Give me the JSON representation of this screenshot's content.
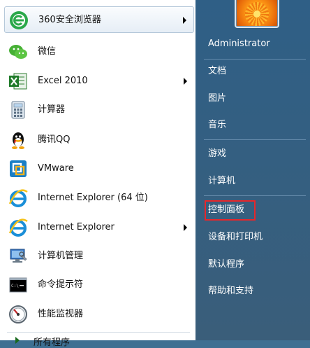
{
  "left_items": [
    {
      "label": "360安全浏览器",
      "icon": "360-browser-icon",
      "has_arrow": true
    },
    {
      "label": "微信",
      "icon": "wechat-icon",
      "has_arrow": false
    },
    {
      "label": "Excel 2010",
      "icon": "excel-icon",
      "has_arrow": true
    },
    {
      "label": "计算器",
      "icon": "calculator-icon",
      "has_arrow": false
    },
    {
      "label": "腾讯QQ",
      "icon": "qq-icon",
      "has_arrow": false
    },
    {
      "label": "VMware",
      "icon": "vmware-icon",
      "has_arrow": false
    },
    {
      "label": "Internet Explorer (64 位)",
      "icon": "ie-icon",
      "has_arrow": false
    },
    {
      "label": "Internet Explorer",
      "icon": "ie-icon",
      "has_arrow": true
    },
    {
      "label": "计算机管理",
      "icon": "computer-management-icon",
      "has_arrow": false
    },
    {
      "label": "命令提示符",
      "icon": "cmd-icon",
      "has_arrow": false
    },
    {
      "label": "性能监视器",
      "icon": "performance-monitor-icon",
      "has_arrow": false
    }
  ],
  "all_programs_label": "所有程序",
  "right_items": [
    {
      "label": "Administrator"
    },
    {
      "label": "文档"
    },
    {
      "label": "图片"
    },
    {
      "label": "音乐"
    },
    {
      "label": "游戏"
    },
    {
      "label": "计算机"
    },
    {
      "label": "控制面板"
    },
    {
      "label": "设备和打印机"
    },
    {
      "label": "默认程序"
    },
    {
      "label": "帮助和支持"
    }
  ],
  "highlighted_item": "控制面板",
  "colors": {
    "highlight_border": "#e8262a",
    "right_pane_bg": "#2f5f86",
    "left_pane_bg": "#ffffff"
  }
}
